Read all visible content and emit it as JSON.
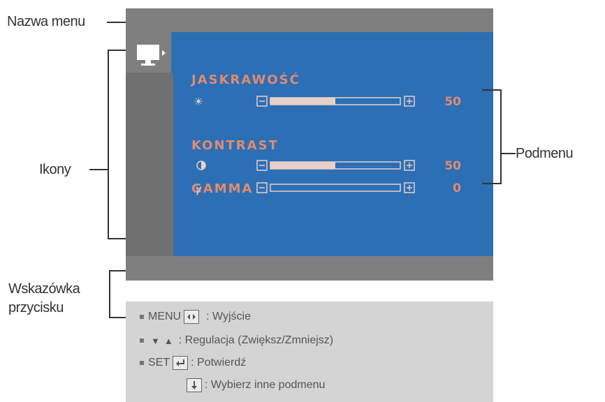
{
  "callouts": {
    "menu_name": "Nazwa menu",
    "icons": "Ikony",
    "submenu": "Podmenu",
    "button_hint_line1": "Wskazówka",
    "button_hint_line2": "przycisku"
  },
  "osd": {
    "items": [
      {
        "title": "JASKRAWOŚĆ",
        "icon": "sun-icon",
        "level": 0.5,
        "value": "50"
      },
      {
        "title": "KONTRAST",
        "icon": "contrast-icon",
        "level": 0.5,
        "value": "50"
      },
      {
        "title": "GAMMA",
        "icon": "gamma-icon",
        "icon_glyph": "γ",
        "level": 0.0,
        "value": "0"
      }
    ]
  },
  "hints": {
    "menu_key": "MENU",
    "menu_action": ": Wyjście",
    "adjust_action": ": Regulacja (Zwiększ/Zmniejsz)",
    "set_key": "SET",
    "set_action": ": Potwierdź",
    "next_action": ": Wybierz inne podmenu"
  },
  "colors": {
    "osd_blue": "#2c6fb5",
    "osd_gray": "#7f7f7f",
    "osd_text": "#e08b70",
    "hint_bg": "#d4d4d4"
  }
}
